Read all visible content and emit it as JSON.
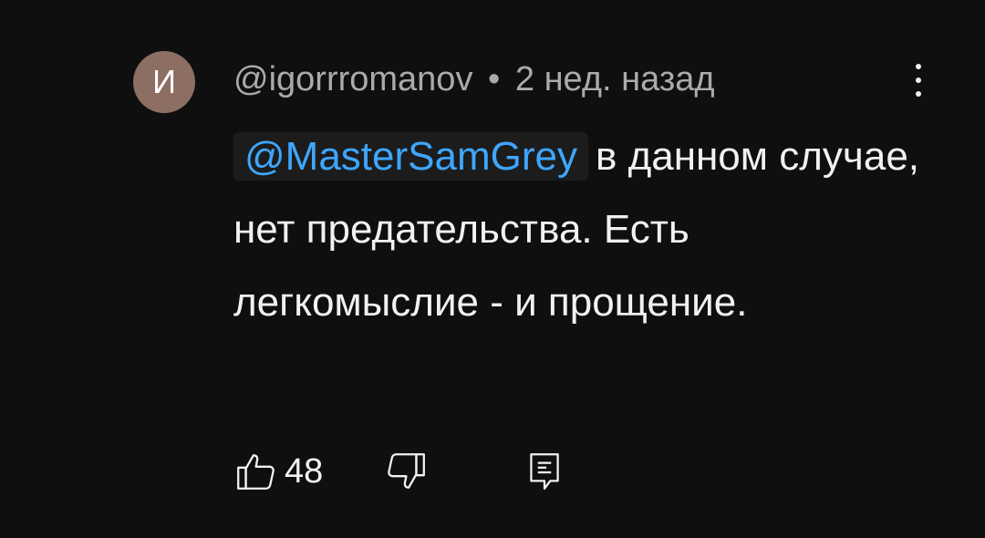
{
  "comment": {
    "avatar_letter": "И",
    "avatar_color": "#8d6e63",
    "author": "@igorrromanov",
    "separator": "•",
    "time": "2 нед. назад",
    "mention": "@MasterSamGrey",
    "text": "в данном случае, нет предательства. Есть легкомыслие - и прощение.",
    "likes": "48",
    "menu_icon": "more-vertical-icon"
  },
  "icons": {
    "like": "thumbs-up-icon",
    "dislike": "thumbs-down-icon",
    "reply": "comment-reply-icon"
  },
  "colors": {
    "background": "#0f0f0f",
    "text": "#f1f1f1",
    "secondary_text": "#aaaaaa",
    "mention": "#3ea6ff",
    "mention_bg": "#1c1c1c"
  }
}
